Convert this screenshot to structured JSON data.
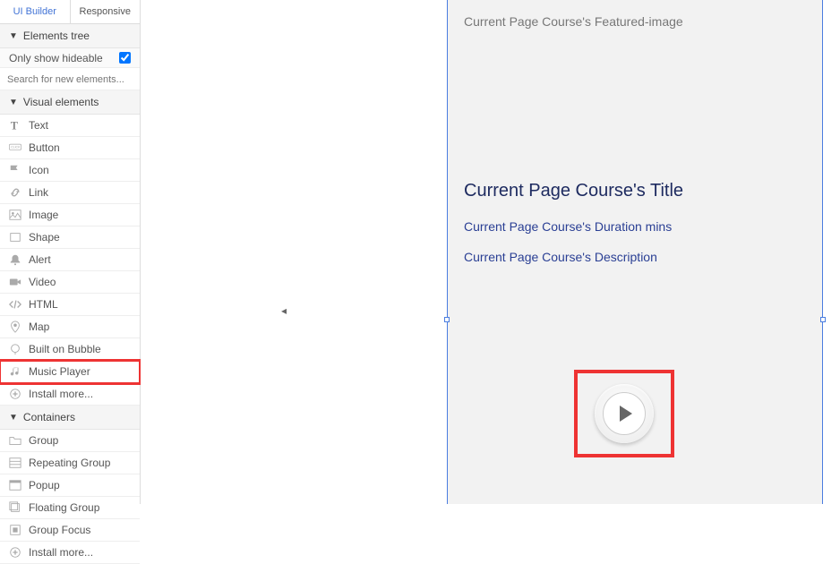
{
  "tabs": {
    "builder": "UI Builder",
    "responsive": "Responsive"
  },
  "sections": {
    "elements_tree": "Elements tree",
    "visual_elements": "Visual elements",
    "containers": "Containers"
  },
  "only_hideable": "Only show hideable",
  "search_placeholder": "Search for new elements...",
  "visual_items": [
    {
      "label": "Text",
      "icon": "text"
    },
    {
      "label": "Button",
      "icon": "button"
    },
    {
      "label": "Icon",
      "icon": "flag"
    },
    {
      "label": "Link",
      "icon": "link"
    },
    {
      "label": "Image",
      "icon": "image"
    },
    {
      "label": "Shape",
      "icon": "shape"
    },
    {
      "label": "Alert",
      "icon": "bell"
    },
    {
      "label": "Video",
      "icon": "video"
    },
    {
      "label": "HTML",
      "icon": "code"
    },
    {
      "label": "Map",
      "icon": "pin"
    },
    {
      "label": "Built on Bubble",
      "icon": "bubble"
    },
    {
      "label": "Music Player",
      "icon": "music"
    },
    {
      "label": "Install more...",
      "icon": "plus"
    }
  ],
  "container_items": [
    {
      "label": "Group",
      "icon": "folder"
    },
    {
      "label": "Repeating Group",
      "icon": "repeat"
    },
    {
      "label": "Popup",
      "icon": "popup"
    },
    {
      "label": "Floating Group",
      "icon": "float"
    },
    {
      "label": "Group Focus",
      "icon": "focus"
    },
    {
      "label": "Install more...",
      "icon": "plus"
    }
  ],
  "canvas": {
    "featured": "Current Page Course's Featured-image",
    "title": "Current Page Course's Title",
    "duration": "Current Page Course's Duration mins",
    "description": "Current Page Course's Description"
  }
}
